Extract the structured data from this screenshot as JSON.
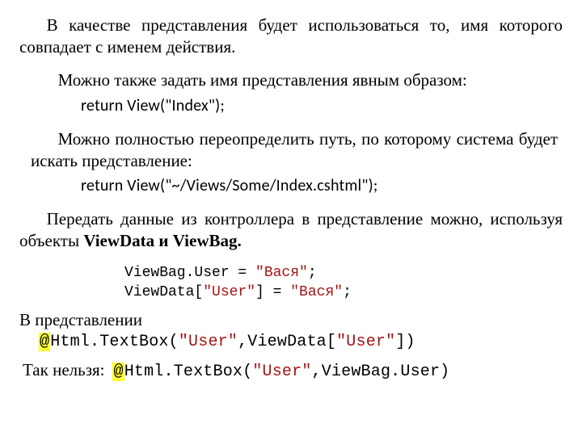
{
  "para1": "В качестве представления будет использоваться то, имя которого совпадает с именем действия.",
  "para2": "Можно также задать имя представления явным образом:",
  "code1": "return  View(\"Index\");",
  "para3": "Можно полностью переопределить путь, по которому система будет искать представление:",
  "code2": "return View(\"~/Views/Some/Index.cshtml\");",
  "para4_a": "Передать данные из контроллера в представление можно, используя объекты ",
  "para4_b": "ViewData и ViewBag.",
  "vb_line_a": "ViewBag.User = ",
  "vb_line_b": "\"Вася\"",
  "vb_line_c": ";",
  "vd_line_a": "ViewData[",
  "vd_line_b": "\"User\"",
  "vd_line_c": "] = ",
  "vd_line_d": "\"Вася\"",
  "vd_line_e": ";",
  "rep_label": "В представлении",
  "rep_at": "@",
  "rep_a": "Html.TextBox(",
  "rep_b": "\"User\"",
  "rep_c": ",ViewData[",
  "rep_d": "\"User\"",
  "rep_e": "])",
  "bad_label": "Так нельзя:",
  "bad_at": "@",
  "bad_a": "Html.TextBox(",
  "bad_b": "\"User\"",
  "bad_c": ",ViewBag.User)"
}
